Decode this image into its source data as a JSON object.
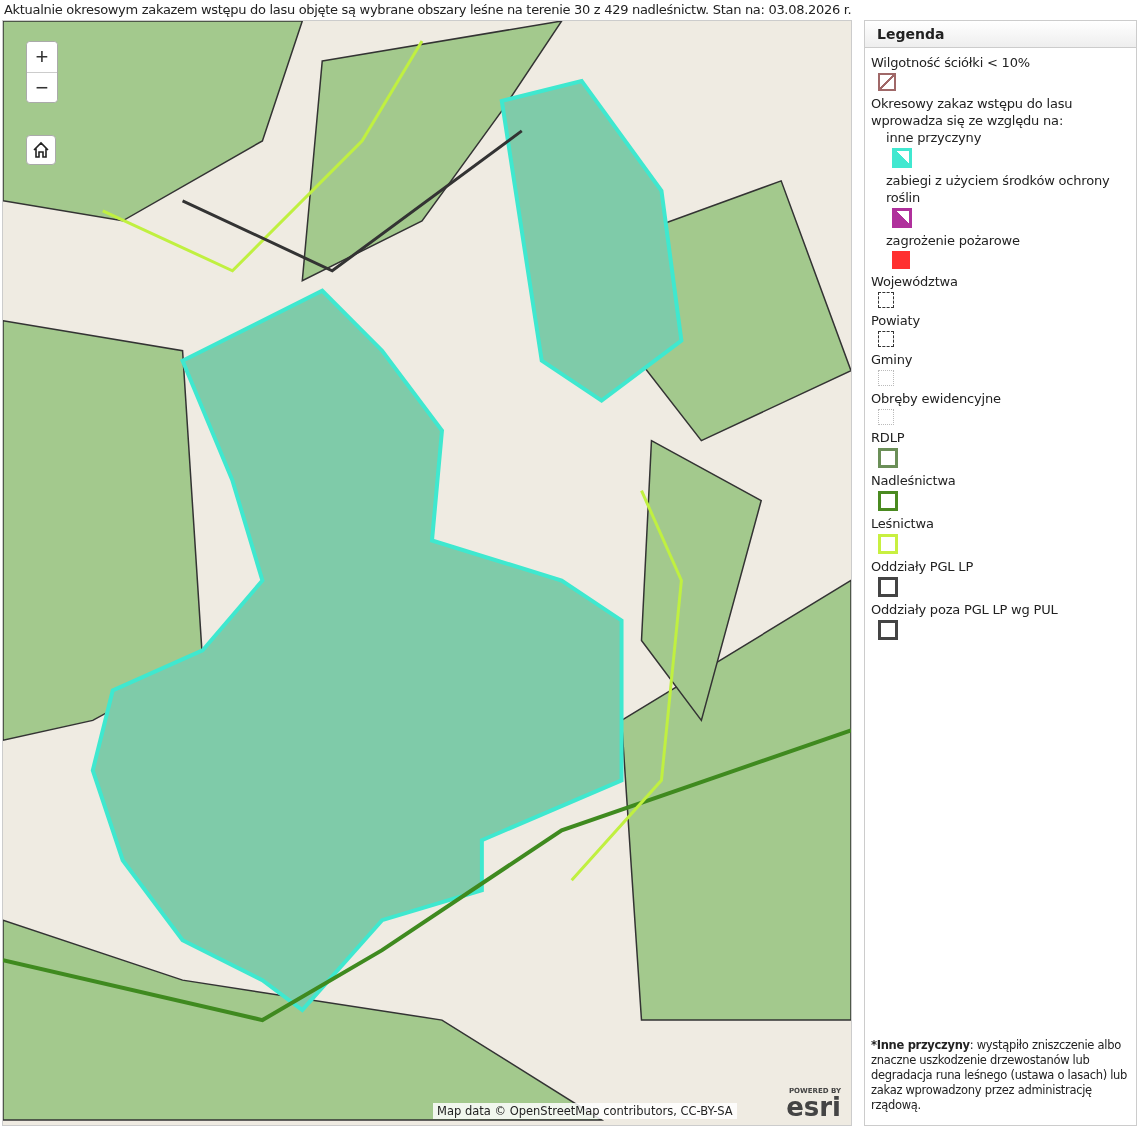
{
  "header": {
    "text": "Aktualnie okresowym zakazem wstępu do lasu objęte są wybrane obszary leśne na terenie 30 z 429 nadleśnictw. Stan na: 03.08.2026 r."
  },
  "map": {
    "zoom_in": "+",
    "zoom_out": "−",
    "attribution": "Map data © OpenStreetMap contributors, CC-BY-SA",
    "logo_small": "POWERED BY",
    "logo": "esri"
  },
  "legend": {
    "title": "Legenda",
    "entries": [
      {
        "label": "Wilgotność ściółki < 10%",
        "kind": "hatch",
        "color": "#a06868"
      },
      {
        "label": "Okresowy zakaz wstępu do lasu wprowadza się ze względu na:",
        "kind": "group",
        "children": [
          {
            "label": "inne przyczyny",
            "kind": "corner",
            "color": "#40e8d0"
          },
          {
            "label": "zabiegi z użyciem środków ochrony roślin",
            "kind": "corner",
            "color": "#b0309c"
          },
          {
            "label": "zagrożenie pożarowe",
            "kind": "fill",
            "color": "#ff3030"
          }
        ]
      },
      {
        "label": "Województwa",
        "kind": "dashed",
        "color": "#333333"
      },
      {
        "label": "Powiaty",
        "kind": "dashed",
        "color": "#333333"
      },
      {
        "label": "Gminy",
        "kind": "dotted",
        "color": "#bbbbbb"
      },
      {
        "label": "Obręby ewidencyjne",
        "kind": "dotted",
        "color": "#bbbbbb"
      },
      {
        "label": "RDLP",
        "kind": "outline",
        "color": "#6b8f58"
      },
      {
        "label": "Nadleśnictwa",
        "kind": "outline",
        "color": "#4a8a20"
      },
      {
        "label": "Leśnictwa",
        "kind": "outline",
        "color": "#c8f040"
      },
      {
        "label": "Oddziały PGL LP",
        "kind": "outline",
        "color": "#444444"
      },
      {
        "label": "Oddziały poza PGL LP wg PUL",
        "kind": "outline",
        "color": "#444444"
      }
    ],
    "note": {
      "term": "*Inne przyczyny",
      "text": ": wystąpiło zniszczenie albo znaczne uszkodzenie drzewostanów lub degradacja runa leśnego (ustawa o lasach) lub zakaz wprowadzony przez administrację rządową."
    }
  }
}
